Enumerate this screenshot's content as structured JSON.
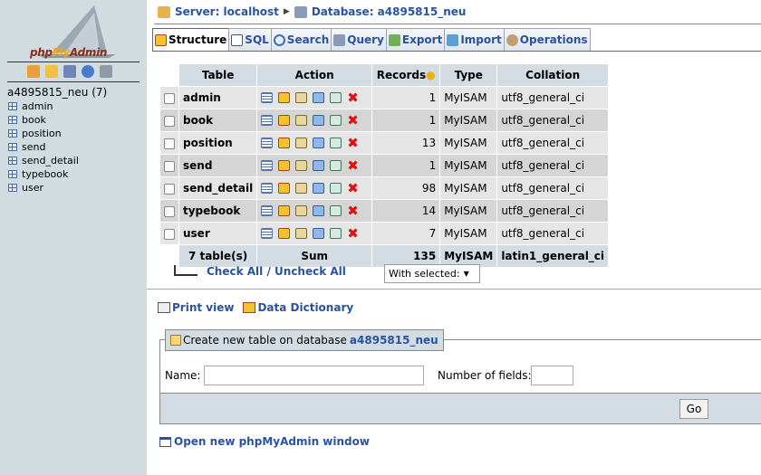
{
  "logo": {
    "prefix": "php",
    "my": "My",
    "suffix": "Admin"
  },
  "left": {
    "db_title": "a4895815_neu (7)",
    "tables": [
      "admin",
      "book",
      "position",
      "send",
      "send_detail",
      "typebook",
      "user"
    ]
  },
  "breadcrumb": {
    "server_label": "Server: localhost",
    "separator": "▶",
    "database_label": "Database: a4895815_neu"
  },
  "tabs": [
    {
      "label": "Structure",
      "icon": "structure-icon",
      "active": true
    },
    {
      "label": "SQL",
      "icon": "sql-icon"
    },
    {
      "label": "Search",
      "icon": "search-icon"
    },
    {
      "label": "Query",
      "icon": "query-icon"
    },
    {
      "label": "Export",
      "icon": "export-icon"
    },
    {
      "label": "Import",
      "icon": "import-icon"
    },
    {
      "label": "Operations",
      "icon": "operations-icon"
    }
  ],
  "table": {
    "headers": {
      "table": "Table",
      "action": "Action",
      "records": "Records",
      "type": "Type",
      "collation": "Collation"
    },
    "rows": [
      {
        "name": "admin",
        "records": "1",
        "type": "MyISAM",
        "collation": "utf8_general_ci"
      },
      {
        "name": "book",
        "records": "1",
        "type": "MyISAM",
        "collation": "utf8_general_ci"
      },
      {
        "name": "position",
        "records": "13",
        "type": "MyISAM",
        "collation": "utf8_general_ci"
      },
      {
        "name": "send",
        "records": "1",
        "type": "MyISAM",
        "collation": "utf8_general_ci"
      },
      {
        "name": "send_detail",
        "records": "98",
        "type": "MyISAM",
        "collation": "utf8_general_ci"
      },
      {
        "name": "typebook",
        "records": "14",
        "type": "MyISAM",
        "collation": "utf8_general_ci"
      },
      {
        "name": "user",
        "records": "7",
        "type": "MyISAM",
        "collation": "utf8_general_ci"
      }
    ],
    "summary": {
      "count": "7 table(s)",
      "label": "Sum",
      "records": "135",
      "type": "MyISAM",
      "collation": "latin1_general_ci"
    }
  },
  "check_all": {
    "check": "Check All",
    "separator": " / ",
    "uncheck": "Uncheck All"
  },
  "with_selected": {
    "value": "With selected:"
  },
  "links": {
    "print_view": "Print view",
    "data_dictionary": "Data Dictionary"
  },
  "create_table": {
    "legend": "Create new table on database",
    "database": "a4895815_neu",
    "name_label": "Name:",
    "fields_label": "Number of fields:",
    "name_value": "",
    "fields_value": "",
    "go": "Go"
  },
  "new_window": "Open new phpMyAdmin window",
  "colors": {
    "link": "#2953a0",
    "header_bg": "#D3DCE3",
    "left_bg": "#D0DCE0",
    "row_odd": "#E5E5E5",
    "row_even": "#D5D5D5",
    "drop": "#dd1111"
  }
}
